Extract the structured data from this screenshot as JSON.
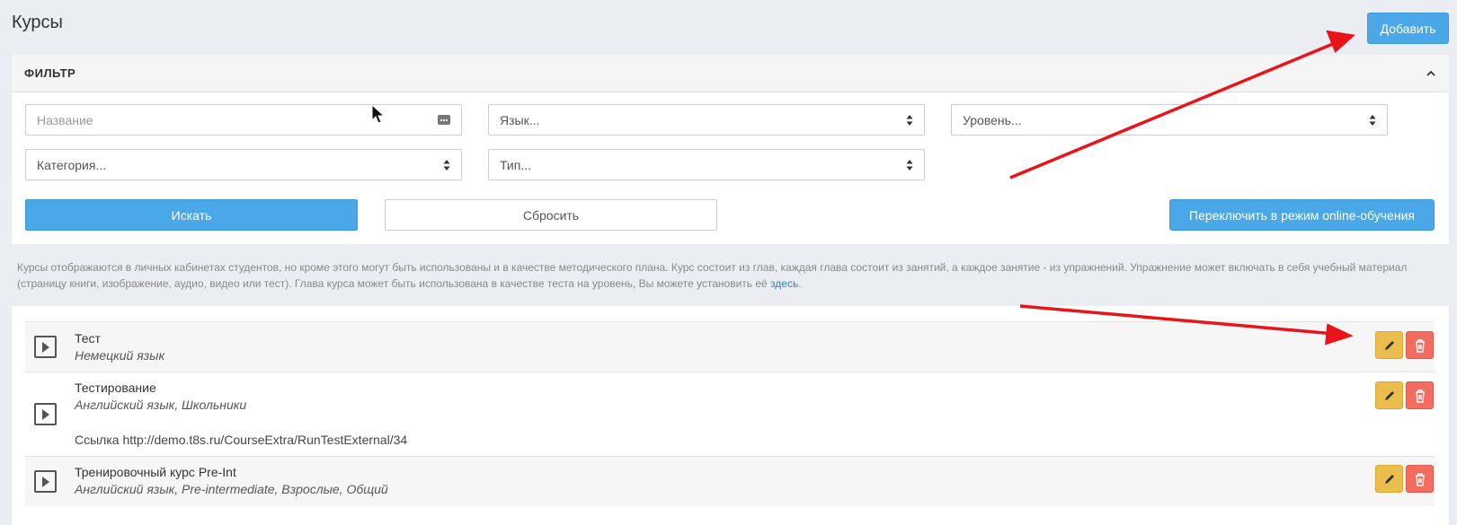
{
  "page": {
    "title": "Курсы",
    "add_button": "Добавить"
  },
  "filter": {
    "title": "ФИЛЬТР",
    "name_placeholder": "Название",
    "language": "Язык...",
    "level": "Уровень...",
    "category": "Категория...",
    "type": "Тип...",
    "search_button": "Искать",
    "reset_button": "Сбросить",
    "online_button": "Переключить в режим online-обучения"
  },
  "help": {
    "text": "Курсы отображаются в личных кабинетах студентов, но кроме этого могут быть использованы и в качестве методического плана. Курс состоит из глав, каждая глава состоит из занятий, а каждое занятие - из упражнений. Упражнение может включать в себя учебный материал (страницу книги, изображение, аудио, видео или тест). Глава курса может быть использована в качестве теста на уровень, Вы можете установить её ",
    "link": "здесь",
    "end": "."
  },
  "courses": [
    {
      "name": "Тест",
      "meta": "Немецкий язык",
      "link": ""
    },
    {
      "name": "Тестирование",
      "meta": "Английский язык, Школьники",
      "link": "Ссылка http://demo.t8s.ru/CourseExtra/RunTestExternal/34"
    },
    {
      "name": "Тренировочный курс Pre-Int",
      "meta": "Английский язык, Pre-intermediate, Взрослые, Общий",
      "link": ""
    }
  ],
  "colors": {
    "primary": "#4aa8e8",
    "edit": "#ebbd4d",
    "delete": "#f26d5f",
    "annotation_arrow": "#e8141a"
  },
  "icons": [
    "chevron-up-icon",
    "dots-icon",
    "sort-arrows-icon",
    "play-icon",
    "pencil-icon",
    "trash-icon",
    "cursor-icon",
    "annotation-arrow"
  ]
}
